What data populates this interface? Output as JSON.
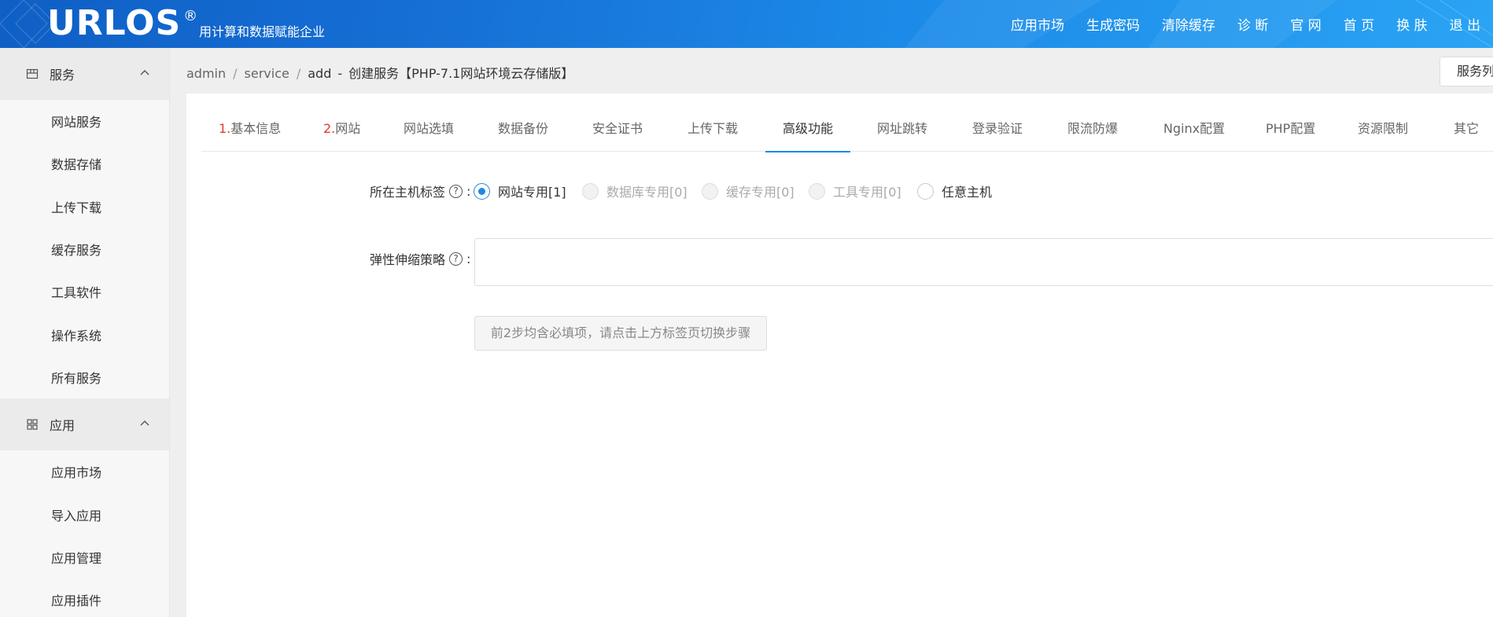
{
  "header": {
    "logo": "URLOS",
    "logo_mark": "®",
    "slogan": "用计算和数据赋能企业",
    "nav": [
      "应用市场",
      "生成密码",
      "清除缓存",
      "诊 断",
      "官 网",
      "首 页",
      "换 肤",
      "退 出"
    ]
  },
  "sidebar": {
    "groups": [
      {
        "label": "服务",
        "icon": "service-icon",
        "items": [
          "网站服务",
          "数据存储",
          "上传下载",
          "缓存服务",
          "工具软件",
          "操作系统",
          "所有服务"
        ]
      },
      {
        "label": "应用",
        "icon": "apps-grid-icon",
        "items": [
          "应用市场",
          "导入应用",
          "应用管理",
          "应用插件"
        ]
      }
    ]
  },
  "breadcrumb": {
    "items": [
      "admin",
      "service",
      "add"
    ],
    "current": "创建服务【PHP-7.1网站环境云存储版】",
    "dash": "-"
  },
  "service_list_button": "服务列表",
  "tabs": [
    {
      "num": "1.",
      "label": "基本信息"
    },
    {
      "num": "2.",
      "label": "网站"
    },
    {
      "num": "",
      "label": "网站选填"
    },
    {
      "num": "",
      "label": "数据备份"
    },
    {
      "num": "",
      "label": "安全证书"
    },
    {
      "num": "",
      "label": "上传下载"
    },
    {
      "num": "",
      "label": "高级功能",
      "active": true
    },
    {
      "num": "",
      "label": "网址跳转"
    },
    {
      "num": "",
      "label": "登录验证"
    },
    {
      "num": "",
      "label": "限流防爆"
    },
    {
      "num": "",
      "label": "Nginx配置"
    },
    {
      "num": "",
      "label": "PHP配置"
    },
    {
      "num": "",
      "label": "资源限制"
    },
    {
      "num": "",
      "label": "其它"
    }
  ],
  "form": {
    "host_tag_label": "所在主机标签",
    "host_tag_options": [
      {
        "label": "网站专用[1]",
        "state": "checked"
      },
      {
        "label": "数据库专用[0]",
        "state": "disabled"
      },
      {
        "label": "缓存专用[0]",
        "state": "disabled"
      },
      {
        "label": "工具专用[0]",
        "state": "disabled"
      },
      {
        "label": "任意主机",
        "state": "enabled"
      }
    ],
    "scaling_policy_label": "弹性伸缩策略",
    "scaling_policy_value": "",
    "colon": ":",
    "help_glyph": "?",
    "submit_hint": "前2步均含必填项，请点击上方标签页切换步骤"
  }
}
